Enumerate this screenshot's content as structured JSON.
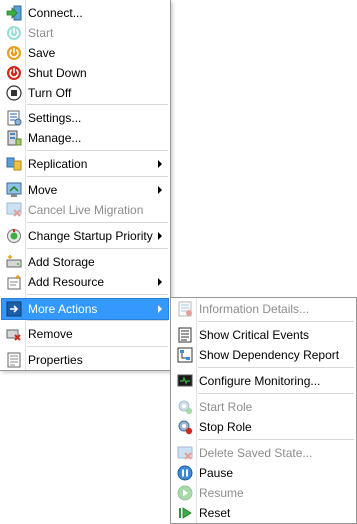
{
  "main_menu": {
    "connect": "Connect...",
    "start": "Start",
    "save": "Save",
    "shut_down": "Shut Down",
    "turn_off": "Turn Off",
    "settings": "Settings...",
    "manage": "Manage...",
    "replication": "Replication",
    "move": "Move",
    "cancel_live_migration": "Cancel Live Migration",
    "change_startup_priority": "Change Startup Priority",
    "add_storage": "Add Storage",
    "add_resource": "Add Resource",
    "more_actions": "More Actions",
    "remove": "Remove",
    "properties": "Properties"
  },
  "sub_menu": {
    "information_details": "Information Details...",
    "show_critical_events": "Show Critical Events",
    "show_dependency_report": "Show Dependency Report",
    "configure_monitoring": "Configure Monitoring...",
    "start_role": "Start Role",
    "stop_role": "Stop Role",
    "delete_saved_state": "Delete Saved State...",
    "pause": "Pause",
    "resume": "Resume",
    "reset": "Reset"
  },
  "colors": {
    "highlight": "#3399ff",
    "disabled_text": "#8d8d8d",
    "start_green": "#2bb5a8",
    "save_orange": "#e8a020",
    "shutdown_red": "#cc2b1d"
  }
}
